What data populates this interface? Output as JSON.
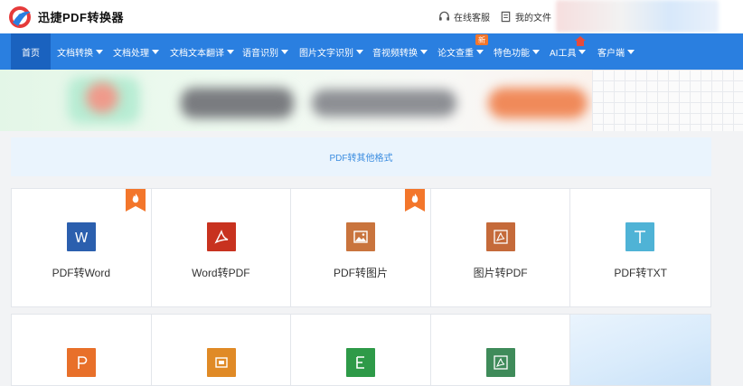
{
  "header": {
    "brand": "迅捷PDF转换器",
    "links": [
      {
        "label": "在线客服",
        "icon": "headset-icon"
      },
      {
        "label": "我的文件",
        "icon": "file-icon"
      }
    ]
  },
  "nav": {
    "home": "首页",
    "items": [
      {
        "label": "文档转换"
      },
      {
        "label": "文档处理"
      },
      {
        "label": "文档文本翻译"
      },
      {
        "label": "语音识别"
      },
      {
        "label": "图片文字识别"
      },
      {
        "label": "音视频转换"
      },
      {
        "label": "论文查重",
        "badge": "新"
      },
      {
        "label": "特色功能"
      },
      {
        "label": "AI工具"
      },
      {
        "label": "客户端"
      }
    ]
  },
  "section": {
    "title": "PDF转其他格式"
  },
  "tools_row1": [
    {
      "label": "PDF转Word",
      "icon": "word-icon",
      "color": "#2b5fae",
      "hot": true
    },
    {
      "label": "Word转PDF",
      "icon": "pdf-icon",
      "color": "#c8321f",
      "hot": false
    },
    {
      "label": "PDF转图片",
      "icon": "image-icon",
      "color": "#c9743d",
      "hot": true
    },
    {
      "label": "图片转PDF",
      "icon": "pdf-icon",
      "color": "#c56a3a",
      "hot": false
    },
    {
      "label": "PDF转TXT",
      "icon": "txt-icon",
      "color": "#4fb3d6",
      "hot": false
    }
  ],
  "tools_row2": [
    {
      "icon": "ppt-icon",
      "color": "#e8702a"
    },
    {
      "icon": "image-edit-icon",
      "color": "#e08a26"
    },
    {
      "icon": "excel-icon",
      "color": "#2e9a48"
    },
    {
      "icon": "pdf-icon",
      "color": "#3f8b5a"
    }
  ],
  "colors": {
    "accent": "#2a7fe0",
    "nav_active": "#1a62bf",
    "hot": "#f3762b"
  }
}
